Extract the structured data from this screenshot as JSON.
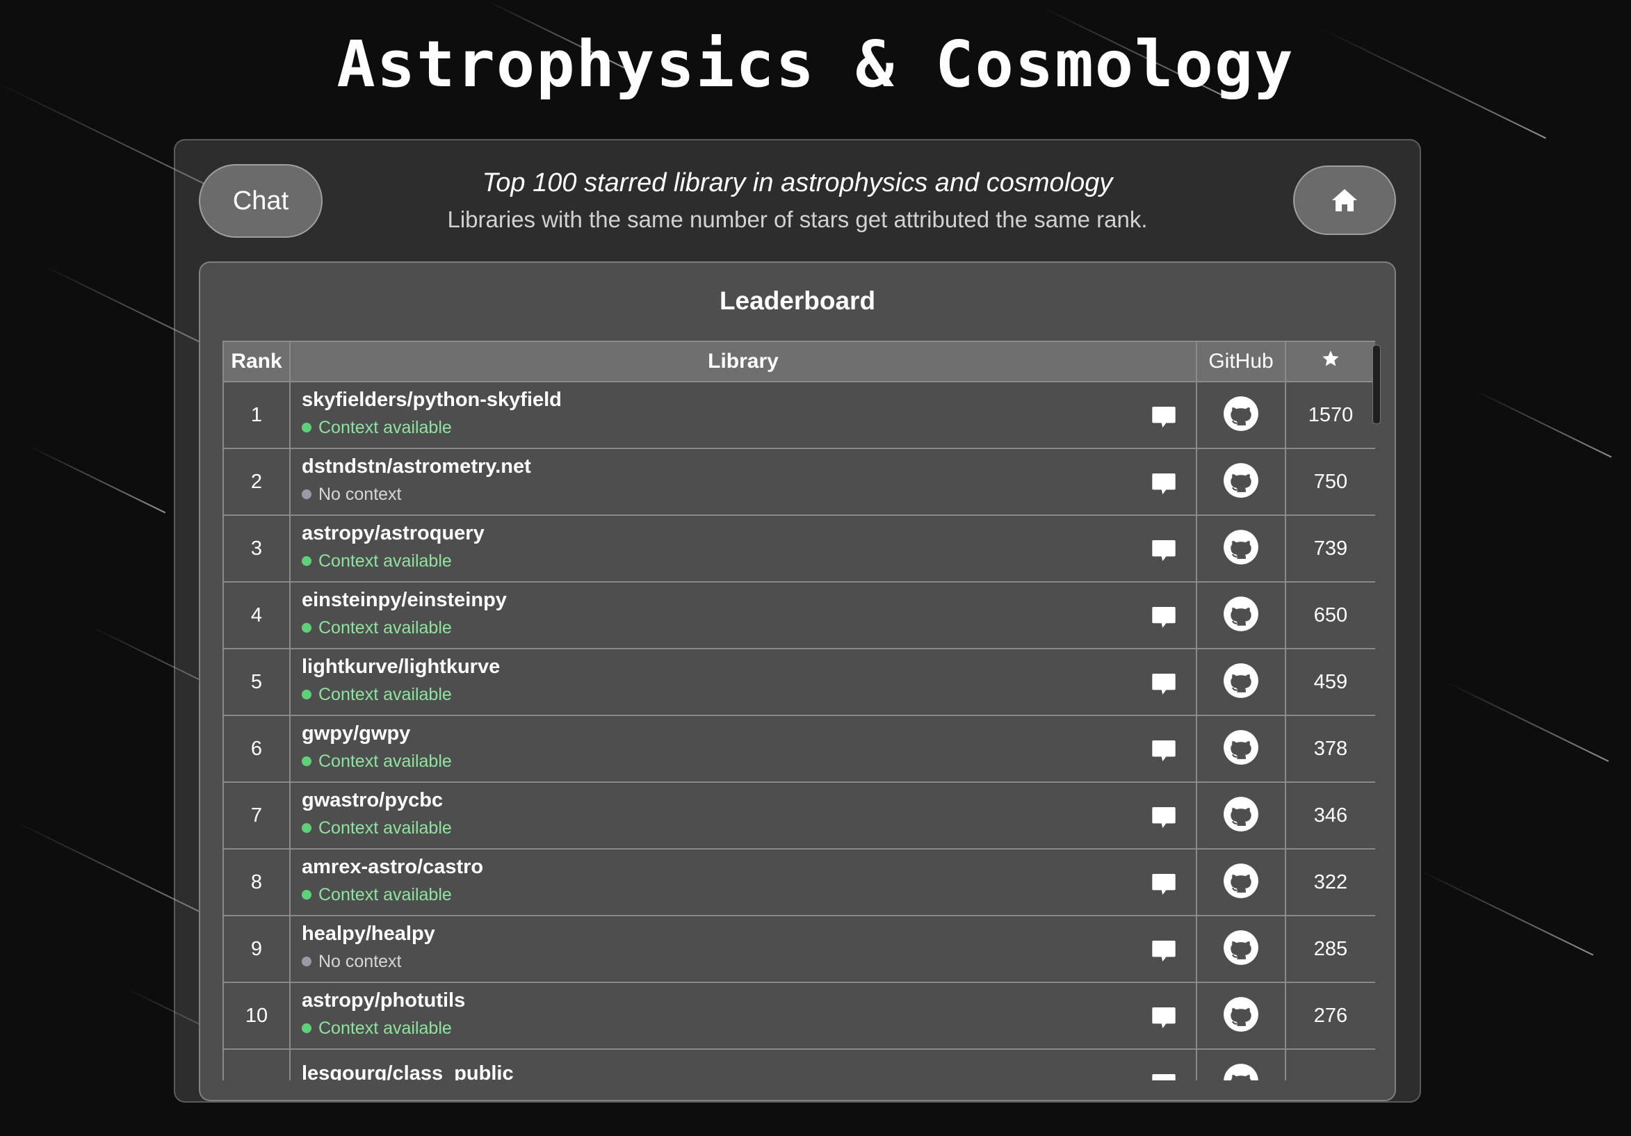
{
  "page": {
    "title": "Astrophysics & Cosmology"
  },
  "header": {
    "chat_label": "Chat",
    "subtitle": "Top 100 starred library in astrophysics and cosmology",
    "note": "Libraries with the same number of stars get attributed the same rank.",
    "home_icon": "home-icon"
  },
  "leaderboard": {
    "title": "Leaderboard",
    "columns": {
      "rank": "Rank",
      "library": "Library",
      "github": "GitHub",
      "stars_icon": "star-icon"
    },
    "rows": [
      {
        "rank": "1",
        "name": "skyfielders/python-skyfield",
        "context": "Context available",
        "has_context": true,
        "stars": "1570"
      },
      {
        "rank": "2",
        "name": "dstndstn/astrometry.net",
        "context": "No context",
        "has_context": false,
        "stars": "750"
      },
      {
        "rank": "3",
        "name": "astropy/astroquery",
        "context": "Context available",
        "has_context": true,
        "stars": "739"
      },
      {
        "rank": "4",
        "name": "einsteinpy/einsteinpy",
        "context": "Context available",
        "has_context": true,
        "stars": "650"
      },
      {
        "rank": "5",
        "name": "lightkurve/lightkurve",
        "context": "Context available",
        "has_context": true,
        "stars": "459"
      },
      {
        "rank": "6",
        "name": "gwpy/gwpy",
        "context": "Context available",
        "has_context": true,
        "stars": "378"
      },
      {
        "rank": "7",
        "name": "gwastro/pycbc",
        "context": "Context available",
        "has_context": true,
        "stars": "346"
      },
      {
        "rank": "8",
        "name": "amrex-astro/castro",
        "context": "Context available",
        "has_context": true,
        "stars": "322"
      },
      {
        "rank": "9",
        "name": "healpy/healpy",
        "context": "No context",
        "has_context": false,
        "stars": "285"
      },
      {
        "rank": "10",
        "name": "astropy/photutils",
        "context": "Context available",
        "has_context": true,
        "stars": "276"
      },
      {
        "rank": "",
        "name": "lesgourg/class_public",
        "context": "",
        "has_context": true,
        "stars": ""
      }
    ]
  },
  "colors": {
    "context_available": "#5fd07a",
    "no_context": "#9a9aa6",
    "context_text_available": "#8ee39f",
    "context_text_none": "#d6d6d6"
  }
}
